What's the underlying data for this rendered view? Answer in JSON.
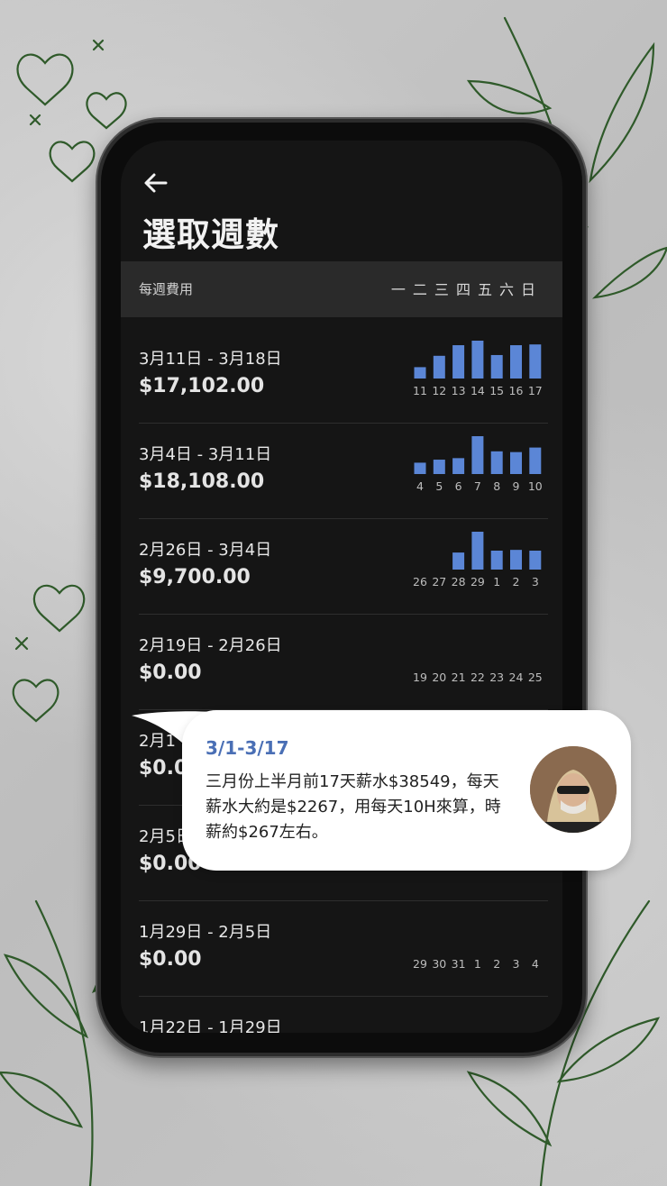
{
  "screen": {
    "title": "選取週數",
    "header_label": "每週費用",
    "weekdays": [
      "一",
      "二",
      "三",
      "四",
      "五",
      "六",
      "日"
    ]
  },
  "weeks": [
    {
      "range": "3月11日 - 3月18日",
      "amount": "$17,102.00",
      "days": [
        "11",
        "12",
        "13",
        "14",
        "15",
        "16",
        "17"
      ],
      "values": [
        0.3,
        0.6,
        0.88,
        1.0,
        0.62,
        0.88,
        0.9
      ]
    },
    {
      "range": "3月4日 - 3月11日",
      "amount": "$18,108.00",
      "days": [
        "4",
        "5",
        "6",
        "7",
        "8",
        "9",
        "10"
      ],
      "values": [
        0.3,
        0.38,
        0.42,
        1.0,
        0.6,
        0.58,
        0.7
      ]
    },
    {
      "range": "2月26日 - 3月4日",
      "amount": "$9,700.00",
      "days": [
        "26",
        "27",
        "28",
        "29",
        "1",
        "2",
        "3"
      ],
      "values": [
        0,
        0,
        0.45,
        1.0,
        0.5,
        0.52,
        0.5
      ]
    },
    {
      "range": "2月19日 - 2月26日",
      "amount": "$0.00",
      "days": [
        "19",
        "20",
        "21",
        "22",
        "23",
        "24",
        "25"
      ],
      "values": [
        0,
        0,
        0,
        0,
        0,
        0,
        0
      ]
    },
    {
      "range": "2月1",
      "amount": "$0.00",
      "days": [],
      "values": []
    },
    {
      "range": "2月5日",
      "amount": "$0.00",
      "days": [],
      "values": []
    },
    {
      "range": "1月29日 - 2月5日",
      "amount": "$0.00",
      "days": [
        "29",
        "30",
        "31",
        "1",
        "2",
        "3",
        "4"
      ],
      "values": [
        0,
        0,
        0,
        0,
        0,
        0,
        0
      ]
    },
    {
      "range": "1月22日 - 1月29日",
      "amount": "",
      "days": [],
      "values": []
    }
  ],
  "comment": {
    "title": "3/1-3/17",
    "text": "三月份上半月前17天薪水$38549，每天薪水大約是$2267，用每天10H來算，時薪約$267左右。"
  },
  "colors": {
    "bar": "#5b86d6",
    "accent": "#4a6fb5",
    "leaf": "#2f5a2a"
  }
}
